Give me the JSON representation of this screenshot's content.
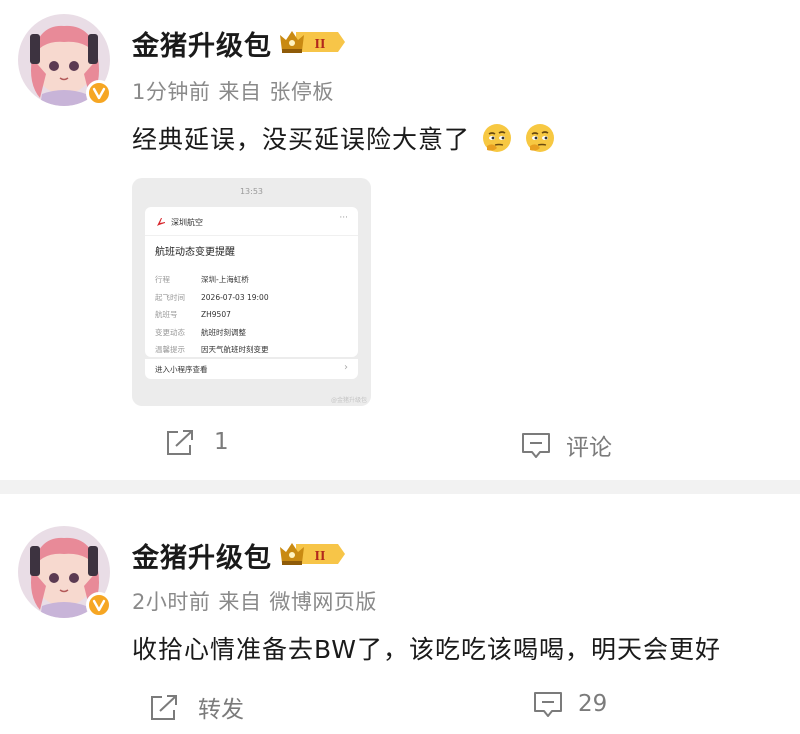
{
  "posts": [
    {
      "username": "金猪升级包",
      "level_badge": "II",
      "time": "1分钟前",
      "source_prefix": "来自",
      "source": "张停板",
      "content": "经典延误，没买延误险大意了",
      "emojis": [
        "thinking-emoji",
        "thinking-emoji"
      ],
      "image": {
        "clock": "13:53",
        "brand": "深圳航空",
        "more": "···",
        "notice_title": "航班动态变更提醒",
        "rows": [
          {
            "k": "行程",
            "v": "深圳-上海虹桥"
          },
          {
            "k": "起飞时间",
            "v": "2026-07-03 19:00"
          },
          {
            "k": "航班号",
            "v": "ZH9507"
          },
          {
            "k": "变更动态",
            "v": "航班时刻调整"
          },
          {
            "k": "温馨提示",
            "v": "因天气航班时刻变更"
          }
        ],
        "mini_program": "进入小程序查看",
        "watermark": "@金猪升级包"
      },
      "actions": {
        "repost": "1",
        "comment": "评论"
      }
    },
    {
      "username": "金猪升级包",
      "level_badge": "II",
      "time": "2小时前",
      "source_prefix": "来自",
      "source": "微博网页版",
      "content": "收拾心情准备去BW了，该吃吃该喝喝，明天会更好",
      "actions": {
        "repost": "转发",
        "comment": "29"
      }
    }
  ],
  "colors": {
    "text": "#1a1a1a",
    "meta": "#8a8a8a",
    "action": "#7b7b7b",
    "verified_badge": "#f6a623",
    "divider": "#f2f2f2"
  }
}
